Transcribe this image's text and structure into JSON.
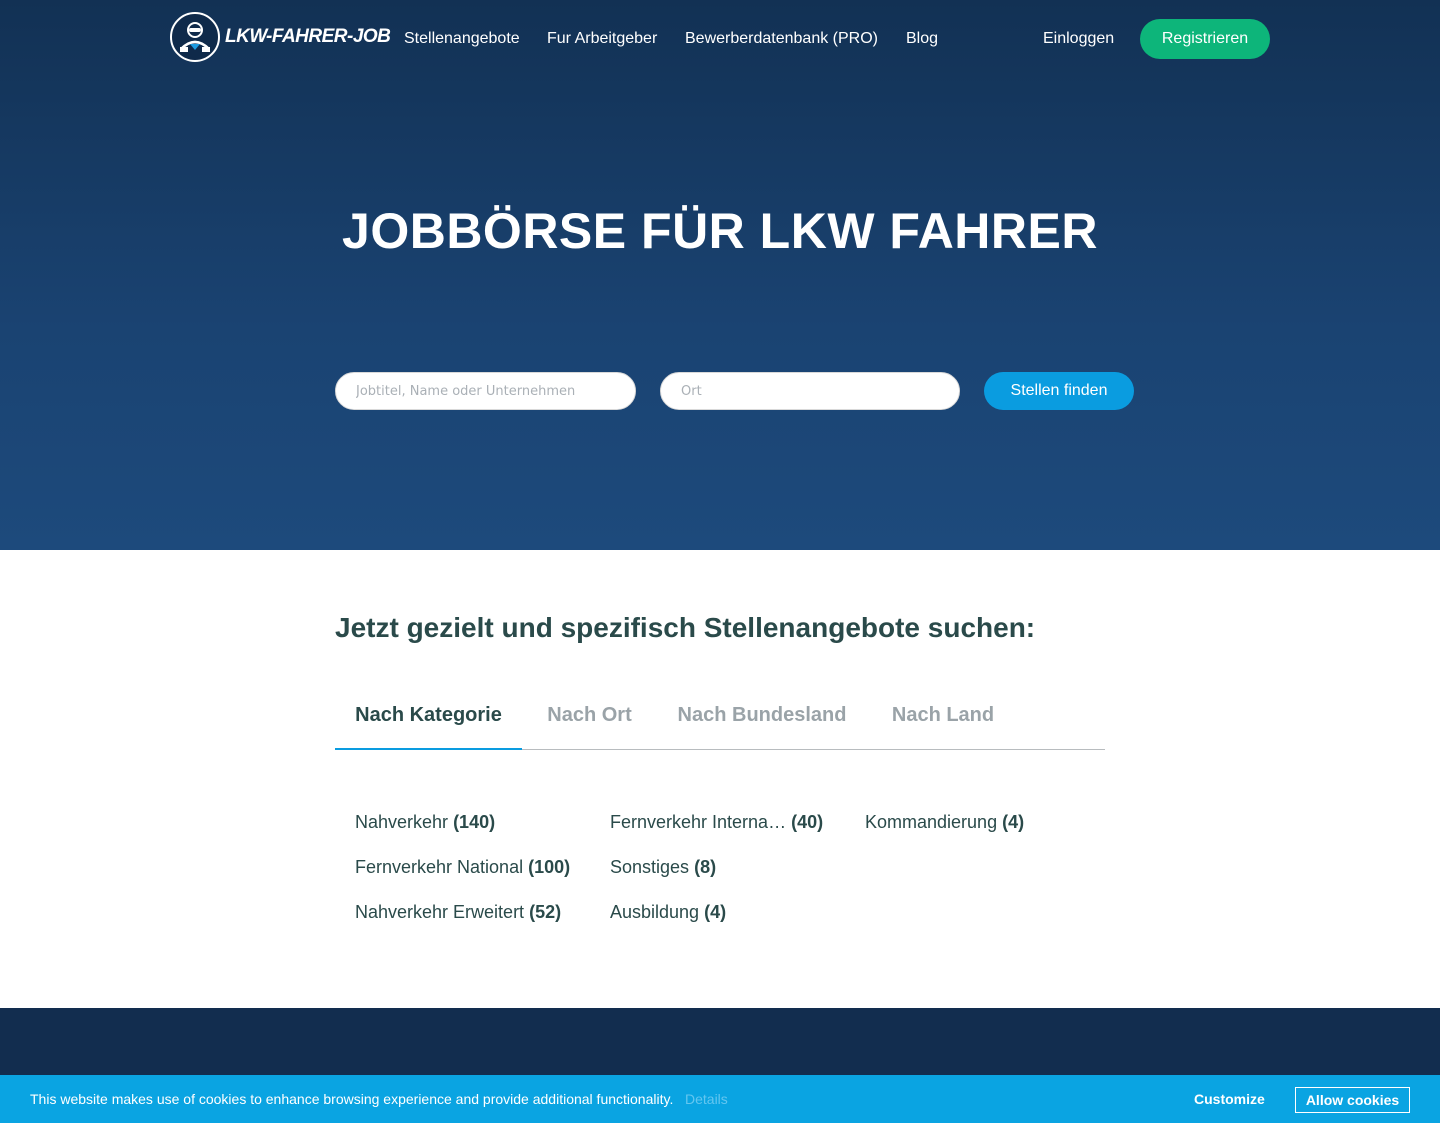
{
  "nav": {
    "logo_text": "LKW-FAHRER-JOB",
    "links": [
      "Stellenangebote",
      "Fur Arbeitgeber",
      "Bewerberdatenbank (PRO)",
      "Blog"
    ],
    "login": "Einloggen",
    "register": "Registrieren"
  },
  "hero": {
    "title": "JOBBÖRSE FÜR LKW FAHRER",
    "search_placeholder": "Jobtitel, Name oder Unternehmen",
    "location_placeholder": "Ort",
    "find_button": "Stellen finden"
  },
  "section": {
    "heading": "Jetzt gezielt und spezifisch Stellenangebote suchen:",
    "tabs": [
      "Nach Kategorie",
      "Nach Ort",
      "Nach Bundesland",
      "Nach Land"
    ],
    "active_tab": "Nach Kategorie",
    "categories": [
      {
        "name": "Nahverkehr",
        "count": "(140)"
      },
      {
        "name": "Fernverkehr National",
        "count": "(100)"
      },
      {
        "name": "Nahverkehr Erweitert",
        "count": "(52)"
      },
      {
        "name": "Fernverkehr Interna…",
        "count": "(40)"
      },
      {
        "name": "Sonstiges",
        "count": "(8)"
      },
      {
        "name": "Ausbildung",
        "count": "(4)"
      },
      {
        "name": "Kommandierung",
        "count": "(4)"
      }
    ]
  },
  "cookie": {
    "text": "This website makes use of cookies to enhance browsing experience and provide additional functionality.",
    "details": "Details",
    "customize": "Customize",
    "allow": "Allow cookies"
  },
  "colors": {
    "hero_top": "#123154",
    "hero_bottom": "#1d4a7c",
    "register_green": "#0db57a",
    "accent_blue": "#0a9ce0",
    "heading_text": "#2a4a4a",
    "cookie_bar": "#0aa4e2"
  }
}
